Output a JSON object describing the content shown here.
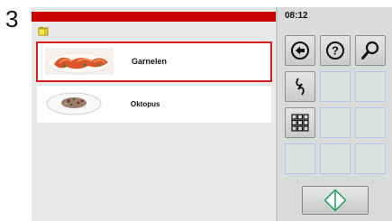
{
  "step": "3",
  "clock": "08:12",
  "recipes": [
    {
      "name": "Garnelen",
      "selected": true
    },
    {
      "name": "Oktopus",
      "selected": false
    }
  ],
  "colors": {
    "header_bar": "#c90000",
    "selection_border": "#d42020",
    "start_arrow": "#2fa36a"
  },
  "icons": {
    "folder": "folder-icon",
    "back": "back-arrow-icon",
    "help": "help-icon",
    "search": "search-icon",
    "link": "chain-link-icon",
    "grid": "grid-view-icon",
    "start": "start-diamond-icon"
  }
}
